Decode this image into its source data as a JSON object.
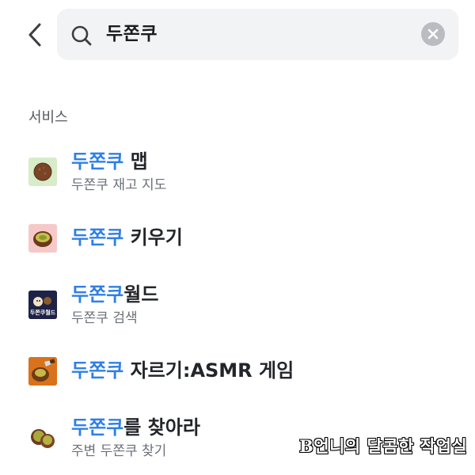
{
  "search": {
    "query": "두쫀쿠"
  },
  "section": {
    "label": "서비스"
  },
  "results": [
    {
      "highlight": "두쫀쿠",
      "rest": " 맵",
      "subtitle": "두쫀쿠 재고 지도",
      "icon": "cookie-map-icon"
    },
    {
      "highlight": "두쫀쿠",
      "rest": " 키우기",
      "subtitle": "",
      "icon": "cookie-grow-icon"
    },
    {
      "highlight": "두쫀쿠",
      "rest": "월드",
      "subtitle": "두쫀쿠 검색",
      "icon": "cookie-world-icon",
      "icon_caption": "두쫀쿠월드"
    },
    {
      "highlight": "두쫀쿠",
      "rest": " 자르기:ASMR 게임",
      "subtitle": "",
      "icon": "knife-cookie-icon"
    },
    {
      "highlight": "두쫀쿠",
      "rest": "를 찾아라",
      "subtitle": "주변 두쫀쿠 찾기",
      "icon": "cookie-find-icon"
    }
  ],
  "watermark": "B언니의 달콤한 작업실",
  "colors": {
    "highlight": "#2f7fe6",
    "search_bg": "#f2f3f5",
    "title": "#22252a",
    "subtitle": "#6b7079"
  }
}
